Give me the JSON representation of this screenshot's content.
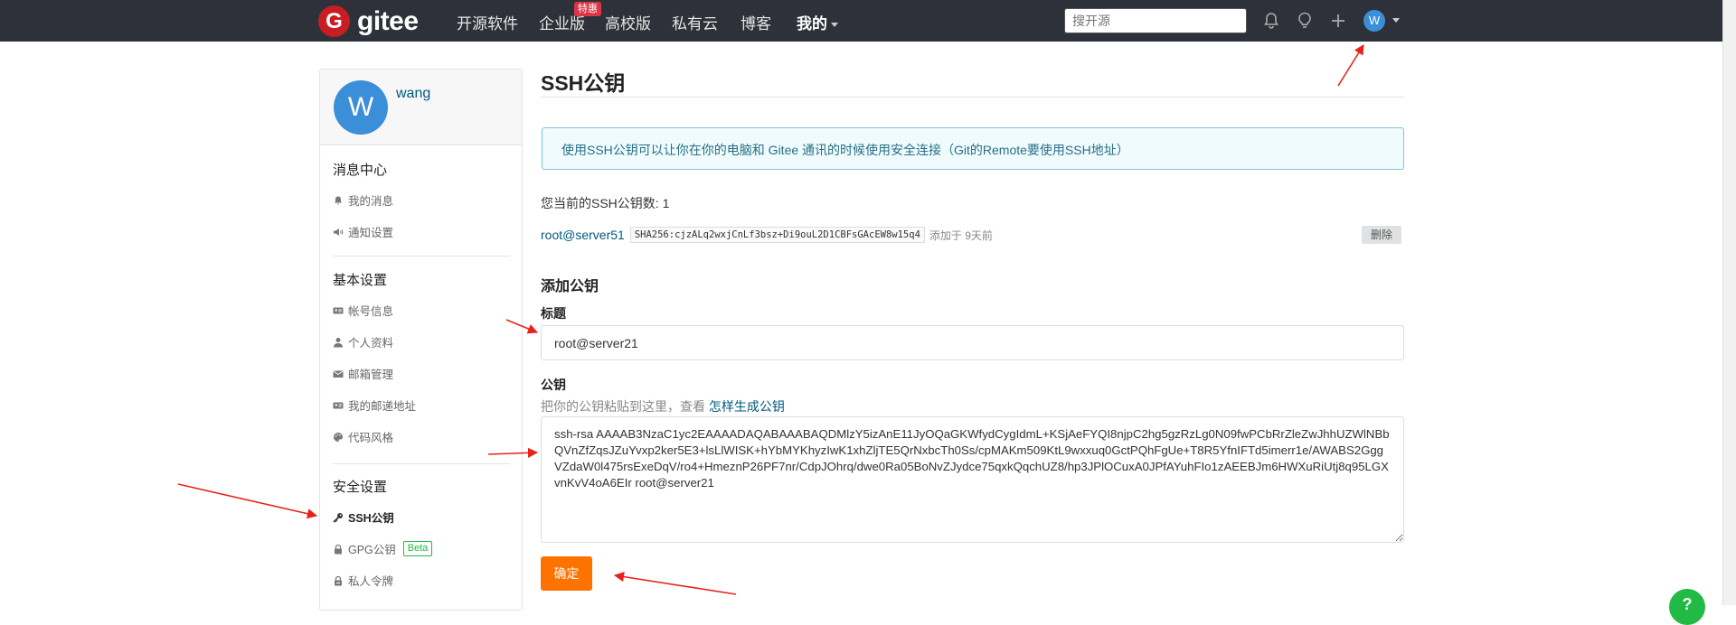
{
  "nav": {
    "logo_mark": "G",
    "logo_text": "gitee",
    "items": [
      "开源软件",
      "企业版",
      "高校版",
      "私有云",
      "博客",
      "我的"
    ],
    "hot_badge": "特惠",
    "search_placeholder": "搜开源",
    "avatar_letter": "W"
  },
  "sidebar": {
    "avatar_letter": "W",
    "username": "wang",
    "groups": [
      {
        "title": "消息中心",
        "items": [
          "我的消息",
          "通知设置"
        ]
      },
      {
        "title": "基本设置",
        "items": [
          "帐号信息",
          "个人资料",
          "邮箱管理",
          "我的邮递地址",
          "代码风格"
        ]
      },
      {
        "title": "安全设置",
        "items": [
          "SSH公钥",
          "GPG公钥",
          "私人令牌"
        ]
      }
    ],
    "beta_label": "Beta"
  },
  "main": {
    "title": "SSH公钥",
    "info": "使用SSH公钥可以让你在你的电脑和 Gitee 通讯的时候使用安全连接（Git的Remote要使用SSH地址）",
    "count_text": "您当前的SSH公钥数: 1",
    "key": {
      "name": "root@server51",
      "fingerprint": "SHA256:cjzALq2wxjCnLf3bsz+Di9ouL2D1CBFsGAcEW8w15q4",
      "added": "添加于 9天前",
      "delete_label": "删除"
    },
    "add_section_title": "添加公钥",
    "title_label": "标题",
    "title_value": "root@server21",
    "key_label": "公钥",
    "hint_text": "把你的公钥粘贴到这里，查看 ",
    "hint_link": "怎样生成公钥",
    "key_value": "ssh-rsa AAAAB3NzaC1yc2EAAAADAQABAAABAQDMlzY5izAnE11JyOQaGKWfydCygIdmL+KSjAeFYQI8njpC2hg5gzRzLg0N09fwPCbRrZleZwJhhUZWlNBbQVnZfZqsJZuYvxp2ker5E3+lsLlWISK+hYbMYKhyzIwK1xhZljTE5QrNxbcTh0Ss/cpMAKm509KtL9wxxuq0GctPQhFgUe+T8R5YfnIFTd5imerr1e/AWABS2GggVZdaW0l475rsExeDqV/ro4+HmeznP26PF7nr/CdpJOhrq/dwe0Ra05BoNvZJydce75qxkQqchUZ8/hp3JPlOCuxA0JPfAYuhFIo1zAEEBJm6HWXuRiUtj8q95LGXvnKvV4oA6EIr root@server21",
    "submit_label": "确定"
  },
  "help_label": "?"
}
